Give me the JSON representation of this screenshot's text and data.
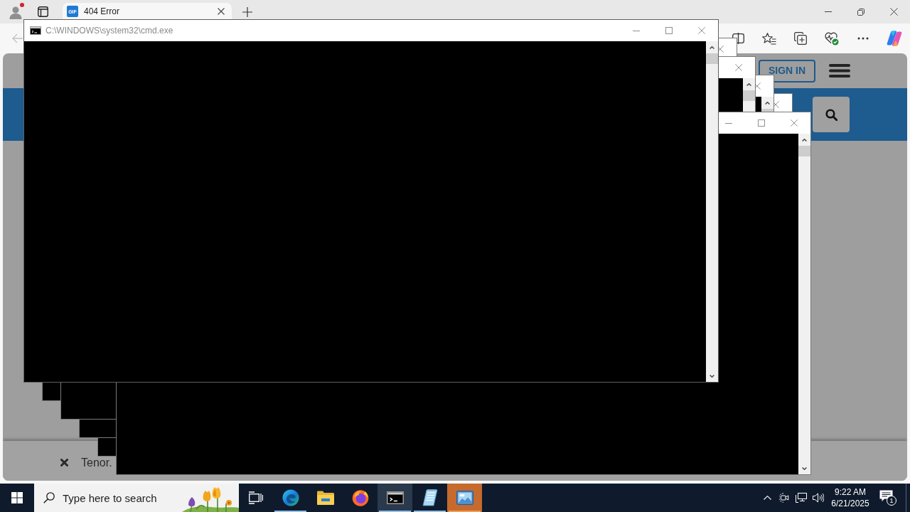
{
  "browser": {
    "profile": {
      "alert": true
    },
    "tabs": [
      {
        "favicon": "GIF",
        "title": "404 Error",
        "selected": true
      }
    ],
    "toolbar": {
      "back": {
        "disabled": true
      }
    },
    "page": {
      "header": {
        "sign_in": "SIGN IN"
      },
      "notice": {
        "text": "Tenor."
      }
    }
  },
  "console_window": {
    "title": "C:\\WINDOWS\\system32\\cmd.exe",
    "active": false
  },
  "taskbar": {
    "search": {
      "placeholder": "Type here to search"
    },
    "apps": [
      {
        "kind": "edge",
        "running": true,
        "selected": false,
        "flashing": false
      },
      {
        "kind": "explorer",
        "running": false,
        "selected": false,
        "flashing": false
      },
      {
        "kind": "firefox",
        "running": false,
        "selected": false,
        "flashing": false
      },
      {
        "kind": "console",
        "running": true,
        "selected": true,
        "flashing": false
      },
      {
        "kind": "notepad",
        "running": true,
        "selected": false,
        "flashing": false
      },
      {
        "kind": "picture",
        "running": true,
        "selected": false,
        "flashing": true
      }
    ],
    "clock": {
      "time": "9:22 AM",
      "date": "6/21/2025"
    },
    "notifications": {
      "count": "1"
    }
  }
}
